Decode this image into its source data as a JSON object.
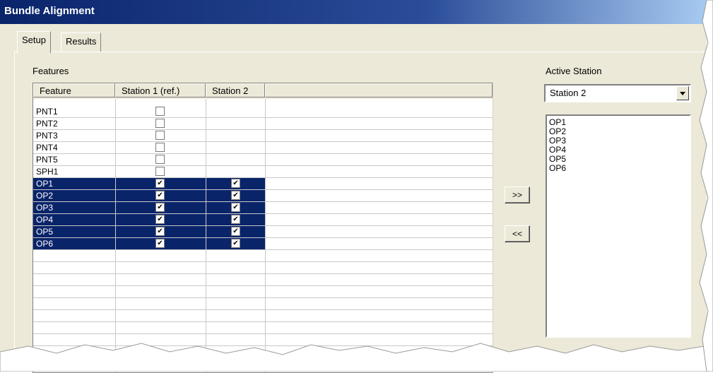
{
  "window": {
    "title": "Bundle Alignment"
  },
  "tabs": [
    {
      "label": "Setup"
    },
    {
      "label": "Results"
    }
  ],
  "features_label": "Features",
  "grid": {
    "columns": [
      "Feature",
      "Station 1 (ref.)",
      "Station 2"
    ],
    "rows": [
      {
        "name": "PNT1",
        "station1": false,
        "station2": null,
        "selected": false
      },
      {
        "name": "PNT2",
        "station1": false,
        "station2": null,
        "selected": false
      },
      {
        "name": "PNT3",
        "station1": false,
        "station2": null,
        "selected": false
      },
      {
        "name": "PNT4",
        "station1": false,
        "station2": null,
        "selected": false
      },
      {
        "name": "PNT5",
        "station1": false,
        "station2": null,
        "selected": false
      },
      {
        "name": "SPH1",
        "station1": false,
        "station2": null,
        "selected": false
      },
      {
        "name": "OP1",
        "station1": true,
        "station2": true,
        "selected": true
      },
      {
        "name": "OP2",
        "station1": true,
        "station2": true,
        "selected": true
      },
      {
        "name": "OP3",
        "station1": true,
        "station2": true,
        "selected": true
      },
      {
        "name": "OP4",
        "station1": true,
        "station2": true,
        "selected": true
      },
      {
        "name": "OP5",
        "station1": true,
        "station2": true,
        "selected": true
      },
      {
        "name": "OP6",
        "station1": true,
        "station2": true,
        "selected": true
      }
    ]
  },
  "buttons": {
    "add": ">>",
    "remove": "<<"
  },
  "active_station": {
    "label": "Active Station",
    "selected": "Station 2",
    "list": [
      "OP1",
      "OP2",
      "OP3",
      "OP4",
      "OP5",
      "OP6"
    ]
  },
  "colors": {
    "selection": "#0a246a",
    "titlebar": "#0a246a",
    "face": "#ece9d8"
  }
}
